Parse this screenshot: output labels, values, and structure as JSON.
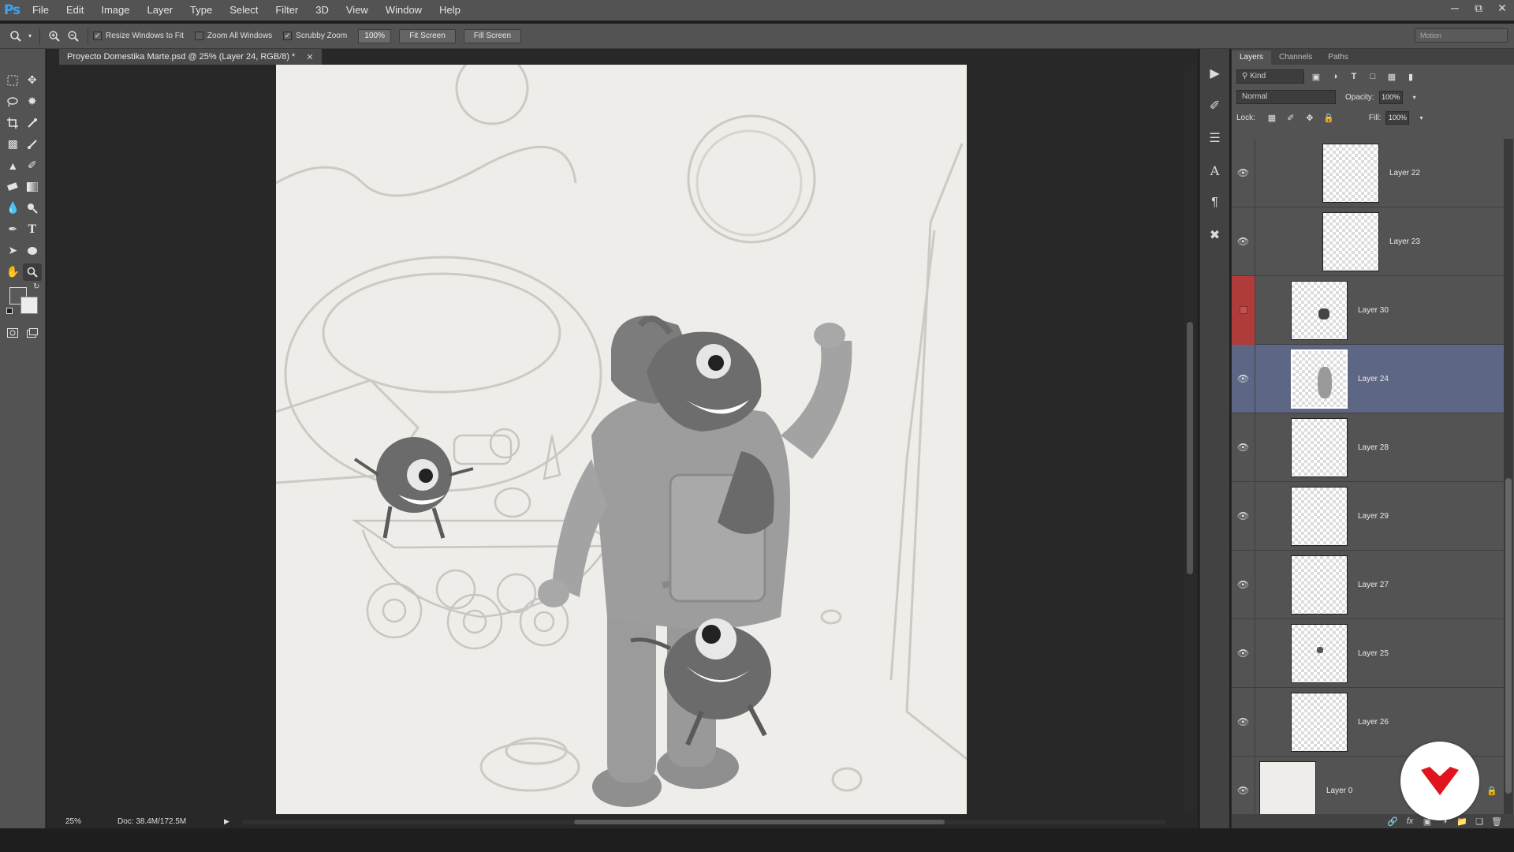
{
  "app": {
    "logo": "Ps"
  },
  "menu": [
    "File",
    "Edit",
    "Image",
    "Layer",
    "Type",
    "Select",
    "Filter",
    "3D",
    "View",
    "Window",
    "Help"
  ],
  "options_bar": {
    "resize_windows": "Resize Windows to Fit",
    "resize_windows_checked": true,
    "zoom_all": "Zoom All Windows",
    "zoom_all_checked": false,
    "scrubby_zoom": "Scrubby Zoom",
    "scrubby_zoom_checked": true,
    "zoom_value": "100%",
    "fit_screen": "Fit Screen",
    "fill_screen": "Fill Screen",
    "workspace": "Motion"
  },
  "document": {
    "tab_title": "Proyecto Domestika Marte.psd @ 25% (Layer 24, RGB/8) *",
    "zoom": "25%",
    "doc_size": "Doc: 38.4M/172.5M"
  },
  "colors": {
    "foreground": "#5a5a5a",
    "background": "#ededed",
    "selected_layer": "#5e6685",
    "hidden_layer_flag": "#b03b3b",
    "badge_accent": "#e0141e"
  },
  "layers_panel": {
    "tabs": [
      "Layers",
      "Channels",
      "Paths"
    ],
    "filter_kind": "Kind",
    "blend_mode": "Normal",
    "opacity_label": "Opacity:",
    "opacity": "100%",
    "lock_label": "Lock:",
    "fill_label": "Fill:",
    "fill": "100%",
    "layers": [
      {
        "name": "Layer 22",
        "visible": true,
        "selected": false
      },
      {
        "name": "Layer 23",
        "visible": true,
        "selected": false
      },
      {
        "name": "Layer 30",
        "visible": false,
        "selected": false
      },
      {
        "name": "Layer 24",
        "visible": true,
        "selected": true
      },
      {
        "name": "Layer 28",
        "visible": true,
        "selected": false
      },
      {
        "name": "Layer 29",
        "visible": true,
        "selected": false
      },
      {
        "name": "Layer 27",
        "visible": true,
        "selected": false
      },
      {
        "name": "Layer 25",
        "visible": true,
        "selected": false
      },
      {
        "name": "Layer 26",
        "visible": true,
        "selected": false
      },
      {
        "name": "Layer 0",
        "visible": true,
        "selected": false,
        "locked": true
      }
    ]
  }
}
